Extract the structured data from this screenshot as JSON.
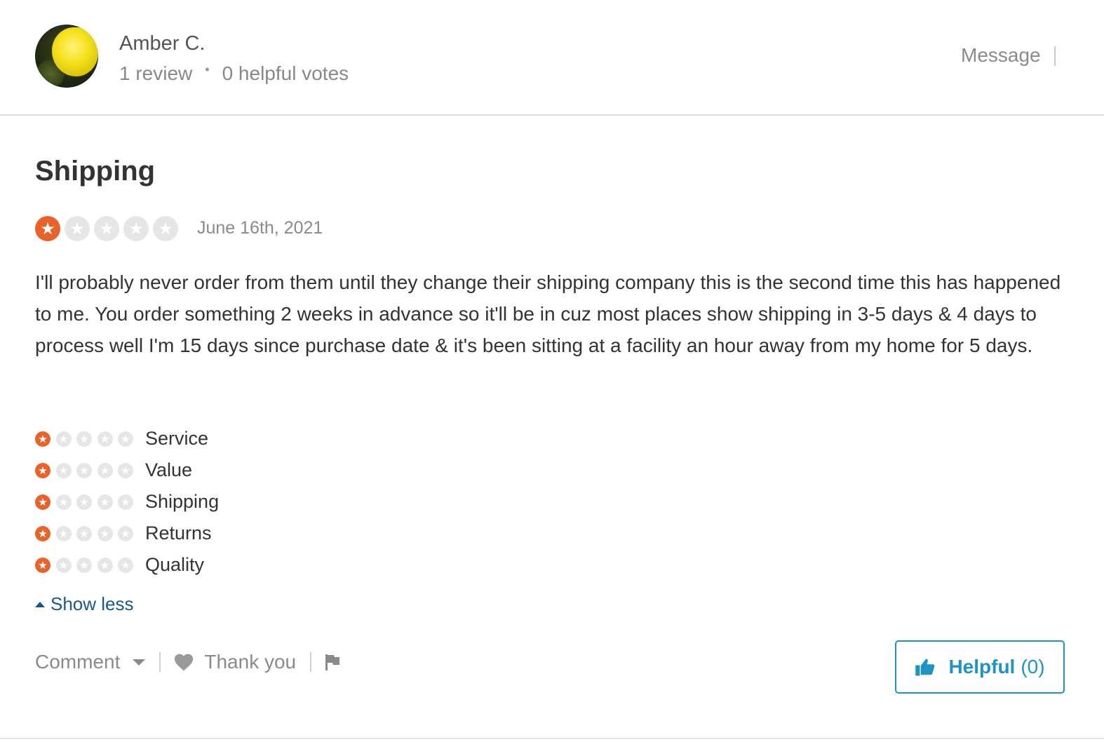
{
  "reviewer": {
    "name": "Amber C.",
    "review_count": "1 review",
    "separator": "•",
    "helpful_votes": "0 helpful votes",
    "message_label": "Message"
  },
  "review": {
    "title": "Shipping",
    "rating": 1,
    "rating_max": 5,
    "date": "June 16th, 2021",
    "body": "I'll probably never order from them until they change their shipping company this is the second time this has happened to me. You order something 2 weeks in advance so it'll be in cuz most places show shipping in 3-5 days & 4 days to process well I'm 15 days since purchase date & it's been sitting at a facility an hour away from my home for 5 days."
  },
  "sub_ratings": [
    {
      "label": "Service",
      "rating": 1
    },
    {
      "label": "Value",
      "rating": 1
    },
    {
      "label": "Shipping",
      "rating": 1
    },
    {
      "label": "Returns",
      "rating": 1
    },
    {
      "label": "Quality",
      "rating": 1
    }
  ],
  "show_less_label": "Show less",
  "actions": {
    "comment_label": "Comment",
    "thank_you_label": "Thank you",
    "helpful_label": "Helpful",
    "helpful_count": "(0)"
  },
  "colors": {
    "star_on": "#e8622a",
    "star_off": "#e6e6e6",
    "link": "#1a5a8a",
    "helpful_accent": "#1f93c4"
  },
  "icons": {
    "star": "star-icon",
    "heart": "heart-icon",
    "flag": "flag-icon",
    "thumbs_up": "thumbs-up-icon",
    "caret_up": "caret-up-icon",
    "caret_down": "caret-down-icon"
  }
}
